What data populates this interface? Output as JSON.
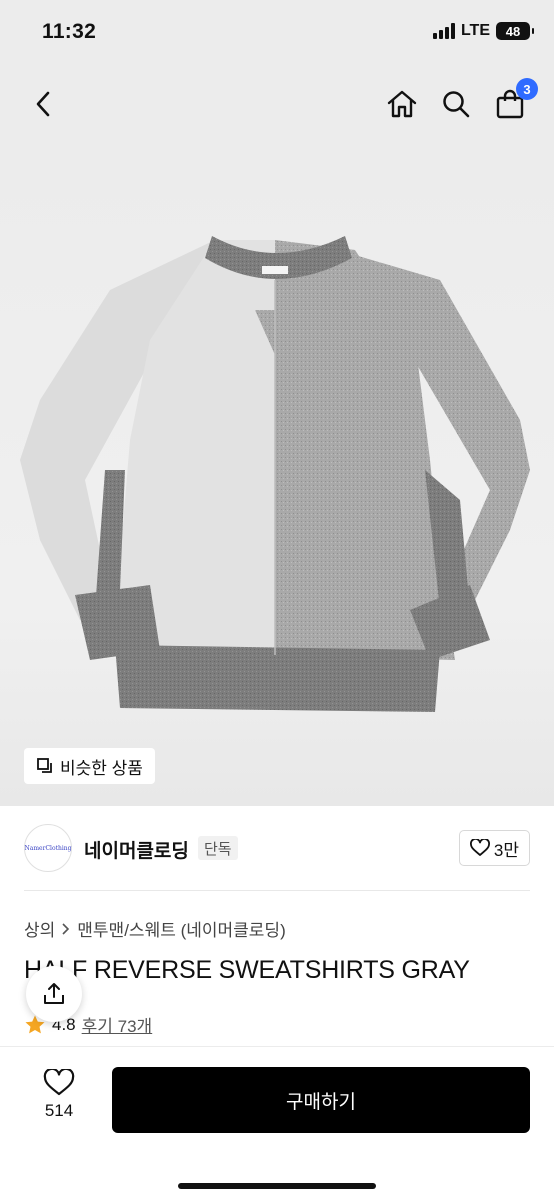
{
  "status_bar": {
    "time": "11:32",
    "network": "LTE",
    "battery": "48"
  },
  "nav": {
    "cart_count": "3"
  },
  "product": {
    "similar_label": "비슷한 상품",
    "brand_name": "네이머클로딩",
    "brand_badge": "단독",
    "brand_logo_text": "NamerClothing",
    "brand_likes": "3만",
    "category": "상의",
    "subcategory": "맨투맨/스웨트 (네이머클로딩)",
    "title": "HALF REVERSE SWEATSHIRTS GRAY",
    "rating": "4.8",
    "review_label": "후기 73개"
  },
  "bottom": {
    "wish_count": "514",
    "buy_label": "구매하기"
  },
  "colors": {
    "accent": "#2f6bff",
    "buy_bg": "#000000",
    "star": "#f5a623"
  }
}
